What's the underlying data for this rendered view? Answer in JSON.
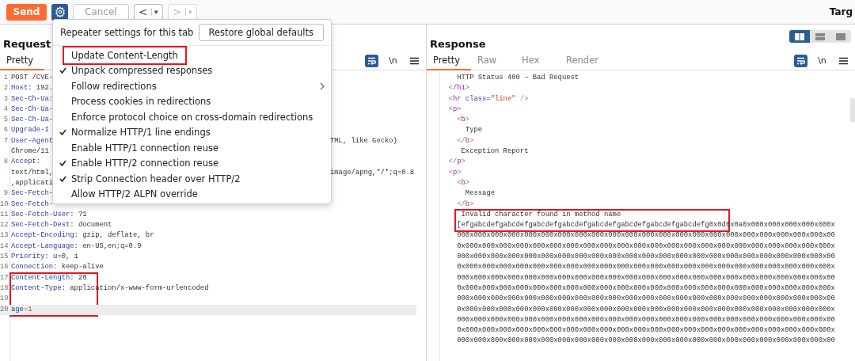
{
  "toolbar": {
    "send": "Send",
    "cancel": {
      "label": "Cancel",
      "disabled": true
    },
    "back": {
      "label": "<",
      "caret": "▾",
      "disabled": false
    },
    "forward": {
      "label": ">",
      "caret": "▾",
      "disabled": true
    },
    "target": "Targ"
  },
  "settings_menu": {
    "title": "Repeater settings for this tab",
    "restore": "Restore global defaults",
    "items": [
      {
        "label": "Update Content-Length",
        "checked": false,
        "marked": true
      },
      {
        "label": "Unpack compressed responses",
        "checked": true,
        "marked": false
      },
      {
        "label": "Follow redirections",
        "checked": false,
        "marked": false,
        "submenu": true
      },
      {
        "label": "Process cookies in redirections",
        "checked": false,
        "marked": false
      },
      {
        "label": "Enforce protocol choice on cross-domain redirections",
        "checked": false,
        "marked": false
      },
      {
        "label": "Normalize HTTP/1 line endings",
        "checked": true,
        "marked": false
      },
      {
        "label": "Enable HTTP/1 connection reuse",
        "checked": false,
        "marked": false
      },
      {
        "label": "Enable HTTP/2 connection reuse",
        "checked": true,
        "marked": false
      },
      {
        "label": "Strip Connection header over HTTP/2",
        "checked": true,
        "marked": false
      },
      {
        "label": "Allow HTTP/2 ALPN override",
        "checked": false,
        "marked": false
      }
    ]
  },
  "request": {
    "title": "Request",
    "tabs": [
      {
        "label": "Pretty",
        "selected": true
      }
    ],
    "newline": "\\n",
    "lines": [
      {
        "num": "1",
        "segments": [
          {
            "kind": "plain",
            "text": "POST /CVE-"
          }
        ]
      },
      {
        "num": "2",
        "segments": [
          {
            "kind": "name",
            "text": "Host:"
          },
          {
            "kind": "value",
            "text": " 192."
          }
        ]
      },
      {
        "num": "3",
        "segments": [
          {
            "kind": "name",
            "text": "Sec-Ch-Ua:"
          }
        ]
      },
      {
        "num": "4",
        "segments": [
          {
            "kind": "name",
            "text": "Sec-Ch-Ua-"
          }
        ]
      },
      {
        "num": "5",
        "segments": [
          {
            "kind": "name",
            "text": "Sec-Ch-Ua-"
          }
        ]
      },
      {
        "num": "6",
        "segments": [
          {
            "kind": "name",
            "text": "Upgrade-I"
          }
        ]
      },
      {
        "num": "7",
        "segments": [
          {
            "kind": "name",
            "text": "User-Agent"
          }
        ],
        "right": "TML, like Gecko)"
      },
      {
        "segments": [
          {
            "kind": "value",
            "text": "Chrome/11"
          }
        ]
      },
      {
        "num": "8",
        "segments": [
          {
            "kind": "name",
            "text": "Accept:"
          }
        ]
      },
      {
        "segments": [
          {
            "kind": "value",
            "text": "text/html,"
          }
        ],
        "right": "image/apng,*/*;q=0.8"
      },
      {
        "segments": [
          {
            "kind": "value",
            "text": ",applicati"
          }
        ]
      },
      {
        "num": "9",
        "segments": [
          {
            "kind": "name",
            "text": "Sec-Fetch-"
          }
        ]
      },
      {
        "num": "10",
        "segments": [
          {
            "kind": "name",
            "text": "Sec-Fetch-"
          }
        ]
      },
      {
        "num": "11",
        "segments": [
          {
            "kind": "name",
            "text": "Sec-Fetch-User"
          },
          {
            "kind": "value",
            "text": ": ?1"
          }
        ]
      },
      {
        "num": "12",
        "segments": [
          {
            "kind": "name",
            "text": "Sec-Fetch-Dest"
          },
          {
            "kind": "value",
            "text": ": document"
          }
        ]
      },
      {
        "num": "13",
        "segments": [
          {
            "kind": "name",
            "text": "Accept-Encoding"
          },
          {
            "kind": "value",
            "text": ": gzip, deflate, br"
          }
        ]
      },
      {
        "num": "14",
        "segments": [
          {
            "kind": "name",
            "text": "Accept-Language"
          },
          {
            "kind": "value",
            "text": ": en-US,en;q=0.9"
          }
        ]
      },
      {
        "num": "15",
        "segments": [
          {
            "kind": "name",
            "text": "Priority"
          },
          {
            "kind": "value",
            "text": ": u=0, i"
          }
        ]
      },
      {
        "num": "16",
        "segments": [
          {
            "kind": "name",
            "text": "Connection"
          },
          {
            "kind": "value",
            "text": ": keep-alive"
          }
        ]
      },
      {
        "num": "17",
        "marked": true,
        "segments": [
          {
            "kind": "name",
            "text": "Content-Length"
          },
          {
            "kind": "value",
            "text": ": 20"
          }
        ]
      },
      {
        "num": "18",
        "marked": true,
        "segments": [
          {
            "kind": "name",
            "text": "Content-Type"
          },
          {
            "kind": "value",
            "text": ": application/x-www-form-urlencoded"
          }
        ]
      },
      {
        "num": "19",
        "marked": true
      },
      {
        "num": "20",
        "marked": true,
        "current": true,
        "segments": [
          {
            "kind": "name",
            "text": "age"
          },
          {
            "kind": "punct",
            "text": "="
          },
          {
            "kind": "string",
            "text": "1"
          }
        ]
      }
    ]
  },
  "response": {
    "title": "Response",
    "layouts": [
      {
        "selected": true
      },
      {
        "selected": false
      },
      {
        "selected": false
      }
    ],
    "tabs": [
      {
        "label": "Pretty",
        "selected": true
      },
      {
        "label": "Raw",
        "selected": false
      },
      {
        "label": "Hex",
        "selected": false
      },
      {
        "label": "Render",
        "selected": false
      }
    ],
    "newline": "\\n",
    "lines": [
      {
        "segments": [
          {
            "kind": "plain",
            "text": "    HTTP Status 400 – Bad Request"
          }
        ]
      },
      {
        "segments": [
          {
            "kind": "punct",
            "text": "  <"
          },
          {
            "kind": "tag",
            "text": "/h1"
          },
          {
            "kind": "punct",
            "text": ">"
          }
        ]
      },
      {
        "segments": [
          {
            "kind": "punct",
            "text": "  <"
          },
          {
            "kind": "tag",
            "text": "hr"
          },
          {
            "kind": "attr",
            "text": " class"
          },
          {
            "kind": "plain",
            "text": "="
          },
          {
            "kind": "string",
            "text": "\"line\""
          },
          {
            "kind": "punct",
            "text": " />"
          }
        ]
      },
      {
        "segments": [
          {
            "kind": "punct",
            "text": "  <"
          },
          {
            "kind": "tag",
            "text": "p"
          },
          {
            "kind": "punct",
            "text": ">"
          }
        ]
      },
      {
        "segments": [
          {
            "kind": "punct",
            "text": "    <"
          },
          {
            "kind": "tag",
            "text": "b"
          },
          {
            "kind": "punct",
            "text": ">"
          }
        ]
      },
      {
        "segments": [
          {
            "kind": "plain",
            "text": "      Type"
          }
        ]
      },
      {
        "segments": [
          {
            "kind": "punct",
            "text": "    </"
          },
          {
            "kind": "tag",
            "text": "b"
          },
          {
            "kind": "punct",
            "text": ">"
          }
        ]
      },
      {
        "segments": [
          {
            "kind": "plain",
            "text": "     Exception Report"
          }
        ]
      },
      {
        "segments": [
          {
            "kind": "punct",
            "text": "  </"
          },
          {
            "kind": "tag",
            "text": "p"
          },
          {
            "kind": "punct",
            "text": ">"
          }
        ]
      },
      {
        "segments": [
          {
            "kind": "punct",
            "text": "  <"
          },
          {
            "kind": "tag",
            "text": "p"
          },
          {
            "kind": "punct",
            "text": ">"
          }
        ]
      },
      {
        "segments": [
          {
            "kind": "punct",
            "text": "    <"
          },
          {
            "kind": "tag",
            "text": "b"
          },
          {
            "kind": "punct",
            "text": ">"
          }
        ]
      },
      {
        "segments": [
          {
            "kind": "plain",
            "text": "      Message"
          }
        ]
      },
      {
        "segments": [
          {
            "kind": "punct",
            "text": "    </"
          },
          {
            "kind": "tag",
            "text": "b"
          },
          {
            "kind": "punct",
            "text": ">"
          }
        ]
      },
      {
        "marked": true,
        "segments": [
          {
            "kind": "plain",
            "text": "     Invalid character found in method name"
          }
        ]
      },
      {
        "marked": true,
        "segments": [
          {
            "kind": "plain",
            "text": "    [efgabcdefgabcdefgabcdefgabcdefgabcdefgabcdefgabcdefgabcdefg0x0d0x0a0x000x000x000x000x000x"
          }
        ]
      },
      {
        "segments": [
          {
            "kind": "plain",
            "text": "    000x000x000x000x000x000x000x000x000x000x000x000x000x000x000x000x000x000x000x000x000x000x00"
          }
        ]
      },
      {
        "segments": [
          {
            "kind": "plain",
            "text": "    0x000x000x000x000x000x000x000x000x000x000x000x000x000x000x000x000x000x000x000x000x000x000x"
          }
        ]
      },
      {
        "segments": [
          {
            "kind": "plain",
            "text": "    000x000x000x000x000x000x000x000x000x000x000x000x000x000x000x000x000x000x000x000x000x000x00"
          }
        ]
      },
      {
        "segments": [
          {
            "kind": "plain",
            "text": "    0x000x000x000x000x000x000x000x000x000x000x000x000x000x000x000x000x000x000x000x000x000x000x"
          }
        ]
      },
      {
        "segments": [
          {
            "kind": "plain",
            "text": "    000x000x000x000x000x000x000x000x000x000x000x000x000x000x000x000x000x000x000x000x000x000x00"
          }
        ]
      },
      {
        "segments": [
          {
            "kind": "plain",
            "text": "    0x000x000x000x000x000x000x000x000x000x000x000x000x000x000x000x000x000x000x000x000x000x000x"
          }
        ]
      },
      {
        "segments": [
          {
            "kind": "plain",
            "text": "    000x000x000x000x000x000x000x000x000x000x000x000x000x000x000x000x000x000x000x000x000x000x00"
          }
        ]
      },
      {
        "segments": [
          {
            "kind": "plain",
            "text": "    0x000x000x000x000x000x000x000x000x000x000x000x000x000x000x000x000x000x000x000x000x000x000x"
          }
        ]
      },
      {
        "segments": [
          {
            "kind": "plain",
            "text": "    000x000x000x000x000x000x000x000x000x000x000x000x000x000x000x000x000x000x000x000x000x000x00"
          }
        ]
      },
      {
        "segments": [
          {
            "kind": "plain",
            "text": "    0x000x000x000x000x000x000x000x000x000x000x000x000x000x000x000x000x000x000x000x000x000x000x"
          }
        ]
      },
      {
        "segments": [
          {
            "kind": "plain",
            "text": "    000x000x000x000x000x000x000x000x000x000x000x000x000x000x000x000x000x000x000x000x000x000x00"
          }
        ]
      }
    ]
  }
}
